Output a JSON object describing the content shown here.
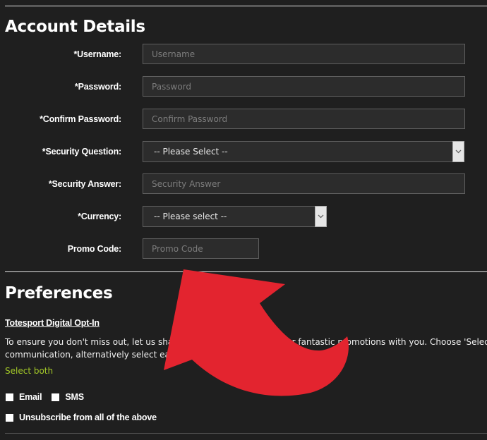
{
  "account": {
    "title": "Account Details",
    "fields": [
      {
        "label": "*Username:",
        "placeholder": "Username",
        "type": "text"
      },
      {
        "label": "*Password:",
        "placeholder": "Password",
        "type": "password"
      },
      {
        "label": "*Confirm Password:",
        "placeholder": "Confirm Password",
        "type": "password"
      },
      {
        "label": "*Security Question:",
        "selected": "-- Please Select --",
        "type": "select"
      },
      {
        "label": "*Security Answer:",
        "placeholder": "Security Answer",
        "type": "text"
      },
      {
        "label": "*Currency:",
        "selected": "-- Please select --",
        "type": "select"
      },
      {
        "label": "Promo Code:",
        "placeholder": "Promo Code",
        "type": "text"
      }
    ]
  },
  "preferences": {
    "title": "Preferences",
    "opt_in_link": "Totesport Digital Opt-In",
    "description_line1": "To ensure you don't miss out, let us share our latest offers and other fantastic promotions with you. Choose 'Select both'",
    "description_line2": "communication, alternatively select each individually.",
    "select_both": "Select both",
    "checkboxes": [
      {
        "label": "Email",
        "checked": false
      },
      {
        "label": "SMS",
        "checked": false
      }
    ],
    "unsubscribe": {
      "label": "Unsubscribe from all of the above",
      "checked": false
    }
  },
  "annotation": {
    "type": "curved-arrow",
    "color": "#e3242f",
    "points_to": "promo-code-field"
  },
  "colors": {
    "background": "#1f1f1f",
    "accent_green": "#a4c928",
    "arrow_red": "#e3242f"
  }
}
